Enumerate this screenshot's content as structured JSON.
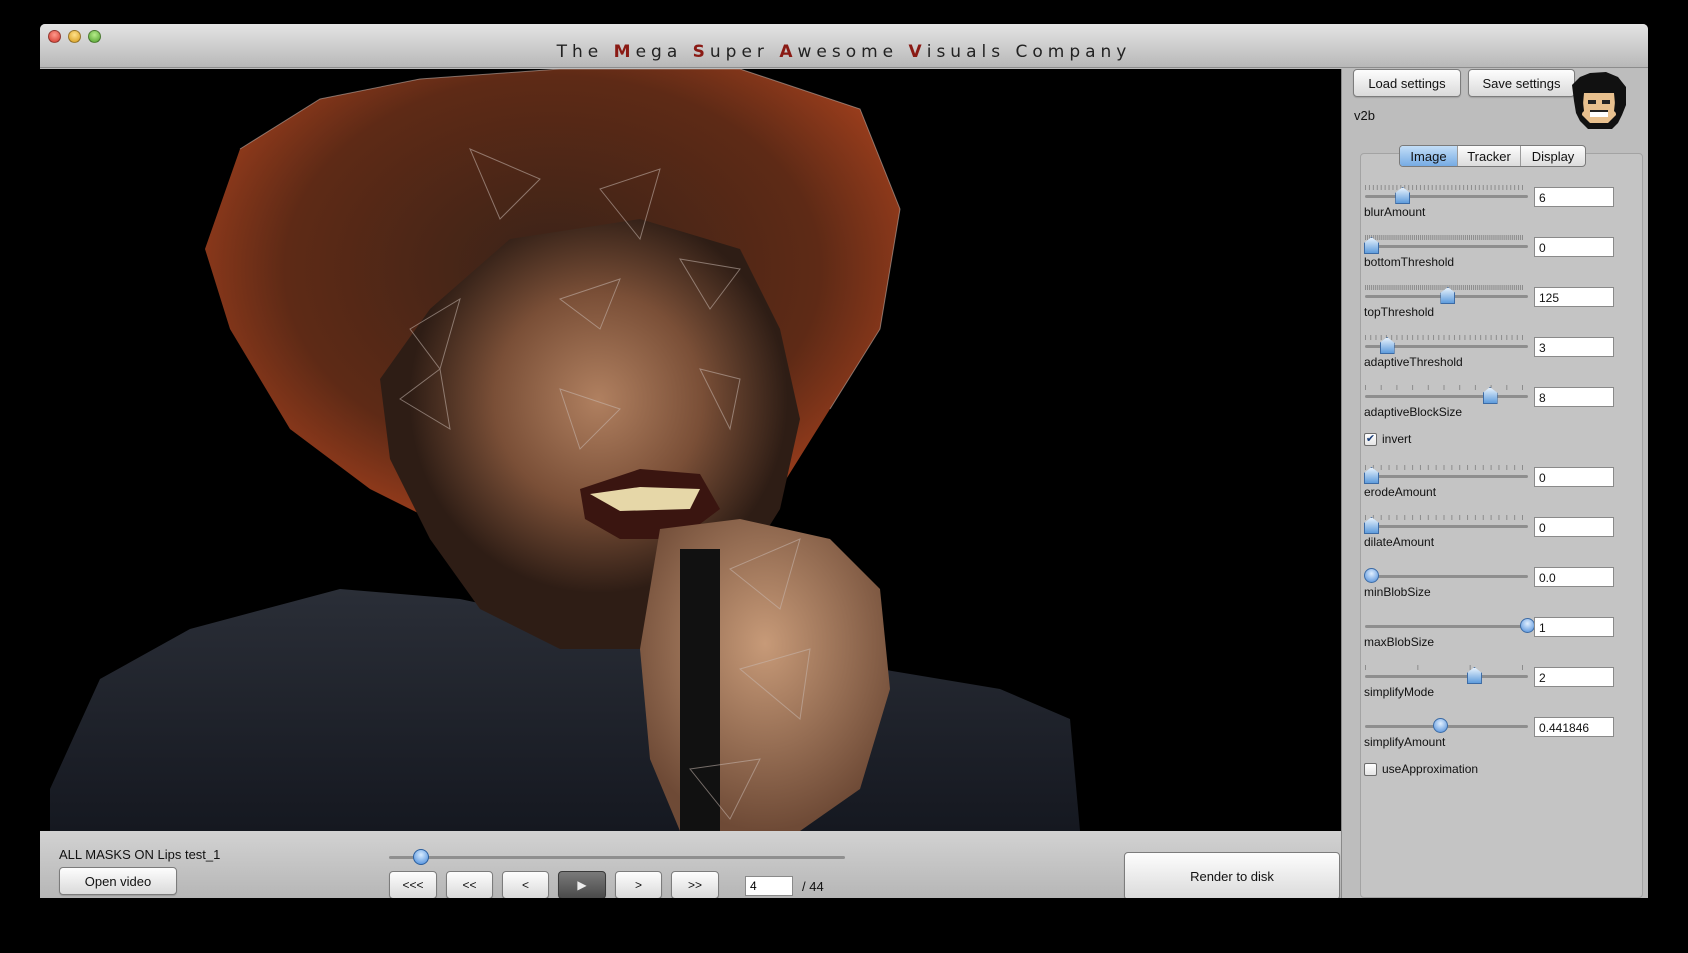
{
  "window": {
    "title_parts": [
      {
        "text": "The ",
        "accent": false
      },
      {
        "text": "M",
        "accent": true
      },
      {
        "text": "ega ",
        "accent": false
      },
      {
        "text": "S",
        "accent": true
      },
      {
        "text": "uper ",
        "accent": false
      },
      {
        "text": "A",
        "accent": true
      },
      {
        "text": "wesome ",
        "accent": false
      },
      {
        "text": "V",
        "accent": true
      },
      {
        "text": "isuals ",
        "accent": false
      },
      {
        "text": "Company",
        "accent": false
      }
    ]
  },
  "status": {
    "text": "ALL MASKS ON Lips test_1"
  },
  "buttons": {
    "open_video": "Open video",
    "render": "Render to disk",
    "load_settings": "Load settings",
    "save_settings": "Save settings"
  },
  "playback": {
    "first": "<<<",
    "rewind": "<<",
    "prev": "<",
    "play": "▶",
    "next": ">",
    "forward": ">>",
    "frame": "4",
    "total": "/  44",
    "progress": 0.07
  },
  "panel": {
    "version": "v2b",
    "tabs": [
      {
        "label": "Image",
        "active": true
      },
      {
        "label": "Tracker",
        "active": false
      },
      {
        "label": "Display",
        "active": false
      }
    ],
    "controls": [
      {
        "kind": "slider",
        "label": "blurAmount",
        "value": "6",
        "pos": 0.2,
        "thumb": "pointer",
        "ticks": 40
      },
      {
        "kind": "slider",
        "label": "bottomThreshold",
        "value": "0",
        "pos": 0.0,
        "thumb": "pointer",
        "ticks": 80
      },
      {
        "kind": "slider",
        "label": "topThreshold",
        "value": "125",
        "pos": 0.49,
        "thumb": "pointer",
        "ticks": 80
      },
      {
        "kind": "slider",
        "label": "adaptiveThreshold",
        "value": "3",
        "pos": 0.1,
        "thumb": "pointer",
        "ticks": 30
      },
      {
        "kind": "slider",
        "label": "adaptiveBlockSize",
        "value": "8",
        "pos": 0.76,
        "thumb": "pointer",
        "ticks": 10
      },
      {
        "kind": "check",
        "label": "invert",
        "checked": true
      },
      {
        "kind": "slider",
        "label": "erodeAmount",
        "value": "0",
        "pos": 0.0,
        "thumb": "pointer",
        "ticks": 20
      },
      {
        "kind": "slider",
        "label": "dilateAmount",
        "value": "0",
        "pos": 0.0,
        "thumb": "pointer",
        "ticks": 20
      },
      {
        "kind": "slider",
        "label": "minBlobSize",
        "value": "0.0",
        "pos": 0.0,
        "thumb": "round",
        "ticks": 0
      },
      {
        "kind": "slider",
        "label": "maxBlobSize",
        "value": "1",
        "pos": 1.0,
        "thumb": "round",
        "ticks": 0
      },
      {
        "kind": "slider",
        "label": "simplifyMode",
        "value": "2",
        "pos": 0.66,
        "thumb": "pointer",
        "ticks": 3
      },
      {
        "kind": "slider",
        "label": "simplifyAmount",
        "value": "0.441846",
        "pos": 0.44,
        "thumb": "round",
        "ticks": 0
      },
      {
        "kind": "check",
        "label": "useApproximation",
        "checked": false
      }
    ]
  }
}
